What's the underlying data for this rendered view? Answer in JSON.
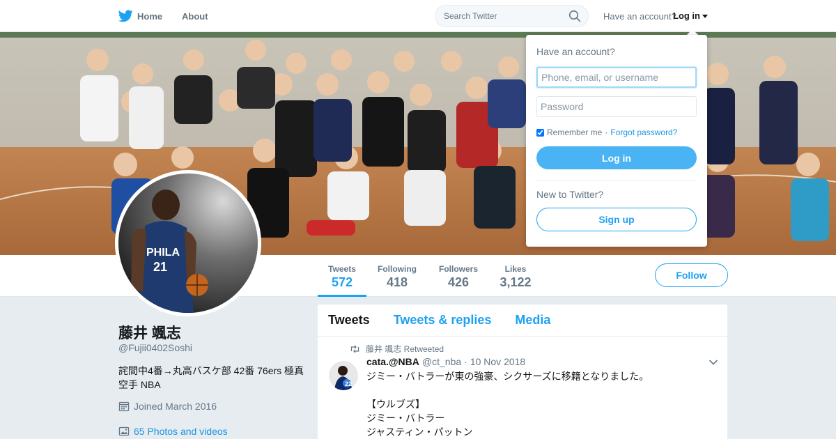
{
  "nav": {
    "home_label": "Home",
    "about_label": "About",
    "search_placeholder": "Search Twitter",
    "have_account": "Have an account?",
    "login_label": "Log in",
    "logo_icon": "twitter-bird-icon",
    "search_icon": "search-icon"
  },
  "colors": {
    "accent": "#1da1f2",
    "link": "#1b95e0",
    "login_button": "#4ab3f4",
    "background": "#e6ecf0"
  },
  "profile": {
    "name": "藤井 颯志",
    "handle": "@Fujii0402Soshi",
    "bio": "詫間中4番→丸高バスケ部 42番 76ers 極真空手 NBA",
    "joined": "Joined March 2016",
    "photos": "65 Photos and videos",
    "follow_label": "Follow"
  },
  "stats": [
    {
      "label": "Tweets",
      "value": "572",
      "active": true
    },
    {
      "label": "Following",
      "value": "418",
      "active": false
    },
    {
      "label": "Followers",
      "value": "426",
      "active": false
    },
    {
      "label": "Likes",
      "value": "3,122",
      "active": false
    }
  ],
  "timeline": {
    "tabs": [
      {
        "label": "Tweets",
        "active": true
      },
      {
        "label": "Tweets & replies",
        "active": false
      },
      {
        "label": "Media",
        "active": false
      }
    ],
    "tweet": {
      "retweet_text": "藤井 颯志 Retweeted",
      "author_name": "cata.@NBA",
      "author_handle": "@ct_nba",
      "separator": "·",
      "date": "10 Nov 2018",
      "text": "ジミー・バトラーが東の強豪、シクサーズに移籍となりました。\n\n【ウルブズ】\nジミー・バトラー\nジャスティン・パットン"
    }
  },
  "login_dropdown": {
    "title": "Have an account?",
    "username_placeholder": "Phone, email, or username",
    "password_placeholder": "Password",
    "remember_label": "Remember me",
    "separator": "·",
    "forgot_label": "Forgot password?",
    "login_button": "Log in",
    "new_to": "New to Twitter?",
    "signup_button": "Sign up"
  }
}
